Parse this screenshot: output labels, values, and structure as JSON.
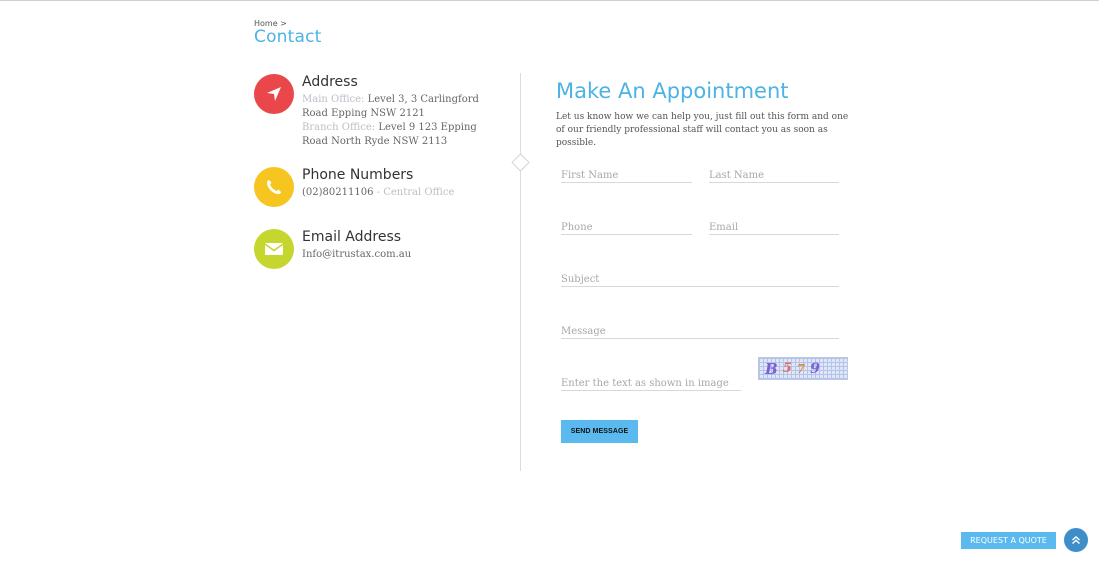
{
  "breadcrumb": {
    "home": "Home",
    "separator": ">"
  },
  "page_title": "Contact",
  "contact_info": {
    "address": {
      "title": "Address",
      "main_label": "Main Office:",
      "main_value": "Level 3, 3 Carlingford Road Epping NSW 2121",
      "branch_label": "Branch Office:",
      "branch_value": "Level 9 123 Epping Road North Ryde NSW 2113",
      "icon": "location-arrow-icon",
      "color": "#e9474a"
    },
    "phone": {
      "title": "Phone Numbers",
      "number": "(02)80211106",
      "separator": " - ",
      "label": "Central Office",
      "icon": "phone-icon",
      "color": "#f7c520"
    },
    "email": {
      "title": "Email Address",
      "value": "Info@itrustax.com.au",
      "icon": "envelope-icon",
      "color": "#c5d62f"
    }
  },
  "form": {
    "title": "Make An Appointment",
    "description": "Let us know how we can help you, just fill out this form and one of our friendly professional staff will contact you as soon as possible.",
    "fields": {
      "first_name": "First Name",
      "last_name": "Last Name",
      "phone": "Phone",
      "email": "Email",
      "subject": "Subject",
      "message": "Message",
      "captcha_input": "Enter the text as shown in image"
    },
    "captcha_chars": [
      "B",
      "5",
      "7",
      "9"
    ],
    "submit_label": "SEND MESSAGE"
  },
  "floating": {
    "quote_label": "REQUEST A QUOTE",
    "top_icon": "chevron-double-up-icon"
  },
  "colors": {
    "accent": "#4db3e4",
    "button": "#5ab9ee"
  }
}
